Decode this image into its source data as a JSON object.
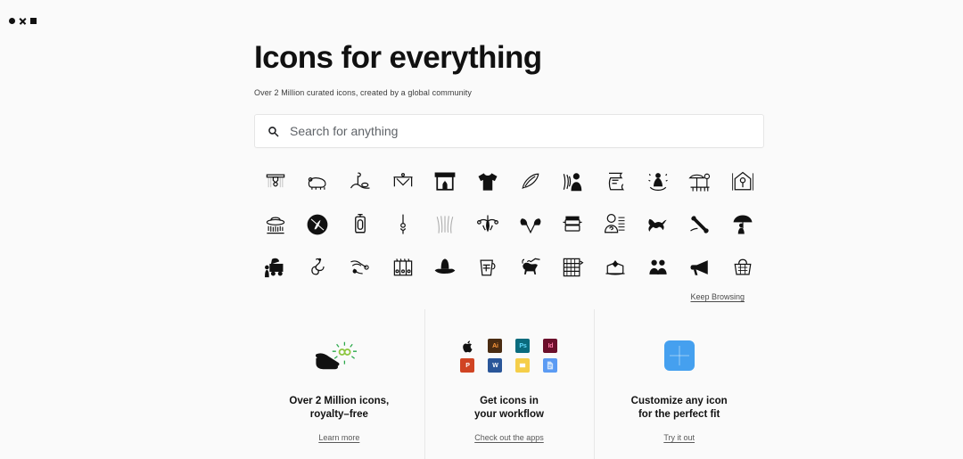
{
  "window": {
    "controls": [
      {
        "name": "circle-control",
        "glyph": "circle"
      },
      {
        "name": "close-control",
        "glyph": "x"
      },
      {
        "name": "square-control",
        "glyph": "square"
      }
    ]
  },
  "hero": {
    "title": "Icons for everything",
    "subtitle": "Over 2 Million curated icons, created by a global community"
  },
  "search": {
    "placeholder": "Search for anything",
    "value": "",
    "icon": "search-icon"
  },
  "icon_grid": {
    "columns": 12,
    "rows": 3,
    "items": [
      {
        "name": "ceiling-fixture-icon"
      },
      {
        "name": "bear-icon"
      },
      {
        "name": "lamp-post-hill-icon"
      },
      {
        "name": "canopy-tent-icon"
      },
      {
        "name": "fireplace-icon"
      },
      {
        "name": "t-shirt-icon"
      },
      {
        "name": "feather-icon"
      },
      {
        "name": "person-wind-icon"
      },
      {
        "name": "scroll-document-icon"
      },
      {
        "name": "rocking-horse-icon"
      },
      {
        "name": "patio-umbrella-icon"
      },
      {
        "name": "birdhouse-icon"
      },
      {
        "name": "flying-saucer-icon"
      },
      {
        "name": "circle-badge-icon"
      },
      {
        "name": "lantern-icon"
      },
      {
        "name": "pendant-light-icon"
      },
      {
        "name": "rain-lines-icon"
      },
      {
        "name": "chandelier-icon"
      },
      {
        "name": "two-bells-icon"
      },
      {
        "name": "steamer-pot-icon"
      },
      {
        "name": "user-question-icon"
      },
      {
        "name": "lizard-icon"
      },
      {
        "name": "bone-tool-icon"
      },
      {
        "name": "umbrella-person-icon"
      },
      {
        "name": "vendor-truck-icon"
      },
      {
        "name": "balloon-dog-icon"
      },
      {
        "name": "crane-machine-icon"
      },
      {
        "name": "vending-machine-icon"
      },
      {
        "name": "cowboy-hat-icon"
      },
      {
        "name": "measuring-cup-icon"
      },
      {
        "name": "bull-market-icon"
      },
      {
        "name": "abacus-icon"
      },
      {
        "name": "jewelry-box-icon"
      },
      {
        "name": "two-people-icon"
      },
      {
        "name": "megaphone-icon"
      },
      {
        "name": "basket-icon"
      }
    ]
  },
  "keep_browsing": {
    "label": "Keep Browsing"
  },
  "features": [
    {
      "id": "royalty-free",
      "art": "hand-infinity-art",
      "title": "Over 2 Million icons,\nroyalty–free",
      "link": "Learn more"
    },
    {
      "id": "workflow",
      "art": "app-logos-art",
      "title": "Get icons in\nyour workflow",
      "link": "Check out the apps",
      "apps": [
        {
          "name": "apple-logo",
          "label": "",
          "color": "transparent"
        },
        {
          "name": "illustrator-logo",
          "label": "Ai",
          "color": "#4a2c12"
        },
        {
          "name": "photoshop-logo",
          "label": "Ps",
          "color": "#0a6b7d"
        },
        {
          "name": "indesign-logo",
          "label": "Id",
          "color": "#6b0f2b"
        },
        {
          "name": "powerpoint-logo",
          "label": "P",
          "color": "#d04423"
        },
        {
          "name": "word-logo",
          "label": "W",
          "color": "#2a5699"
        },
        {
          "name": "slides-logo",
          "label": "",
          "color": "#f5ce49"
        },
        {
          "name": "docs-logo",
          "label": "",
          "color": "#5b9bf3"
        }
      ]
    },
    {
      "id": "customize",
      "art": "blue-tile-art",
      "title": "Customize any icon\nfor the perfect fit",
      "link": "Try it out"
    }
  ],
  "colors": {
    "background": "#fafafa",
    "text": "#111111",
    "muted": "#5a5a5a",
    "divider": "#e8e8e8",
    "accent_blue": "#45a0ef",
    "accent_green": "#7ac943"
  }
}
